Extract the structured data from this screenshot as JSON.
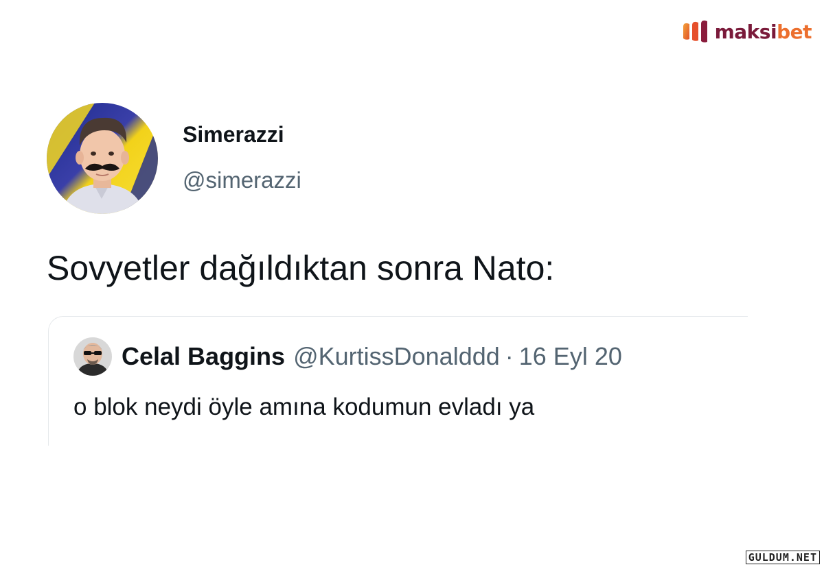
{
  "brand": {
    "maksi": "maksi",
    "bet": "bet",
    "colors": {
      "maksi": "#7a1a3a",
      "bet": "#ec6f2e"
    },
    "icon": "maksibet-logo-mark"
  },
  "tweet": {
    "display_name": "Simerazzi",
    "handle": "@simerazzi",
    "text": "Sovyetler dağıldıktan sonra Nato:",
    "avatar_icon": "profile-photo-boy-mustache"
  },
  "quote": {
    "display_name": "Celal Baggins",
    "handle": "@KurtissDonalddd",
    "separator": "·",
    "date": "16 Eyl 20",
    "text": "o blok neydi öyle amına kodumun evladı ya",
    "avatar_icon": "profile-photo-man-sunglasses"
  },
  "watermark": "GULDUM.NET",
  "colors": {
    "primary_text": "#0f1419",
    "secondary_text": "#536471",
    "border": "#e6e9ec"
  }
}
